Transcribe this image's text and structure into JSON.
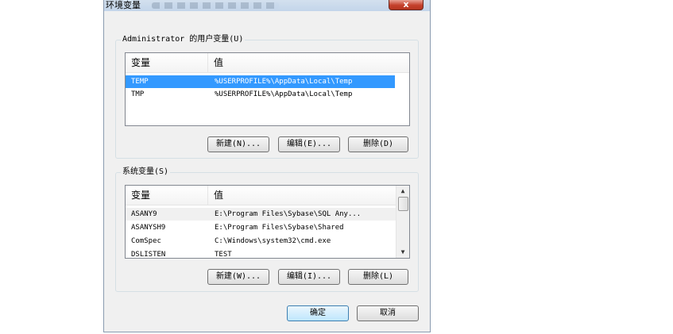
{
  "window": {
    "title": "环境变量",
    "close_label": "x"
  },
  "user_vars": {
    "label": "Administrator 的用户变量(U)",
    "columns": [
      "变量",
      "值"
    ],
    "rows": [
      {
        "name": "TEMP",
        "value": "%USERPROFILE%\\AppData\\Local\\Temp",
        "selected": true
      },
      {
        "name": "TMP",
        "value": "%USERPROFILE%\\AppData\\Local\\Temp",
        "selected": false
      }
    ],
    "buttons": {
      "new": "新建(N)...",
      "edit": "编辑(E)...",
      "delete": "删除(D)"
    }
  },
  "system_vars": {
    "label": "系统变量(S)",
    "columns": [
      "变量",
      "值"
    ],
    "rows": [
      {
        "name": "ASANY9",
        "value": "E:\\Program Files\\Sybase\\SQL Any..."
      },
      {
        "name": "ASANYSH9",
        "value": "E:\\Program Files\\Sybase\\Shared"
      },
      {
        "name": "ComSpec",
        "value": "C:\\Windows\\system32\\cmd.exe"
      },
      {
        "name": "DSLISTEN",
        "value": "TEST"
      }
    ],
    "buttons": {
      "new": "新建(W)...",
      "edit": "编辑(I)...",
      "delete": "删除(L)"
    },
    "scroll_up_icon": "▲",
    "scroll_down_icon": "▼"
  },
  "footer": {
    "ok": "确定",
    "cancel": "取消"
  }
}
